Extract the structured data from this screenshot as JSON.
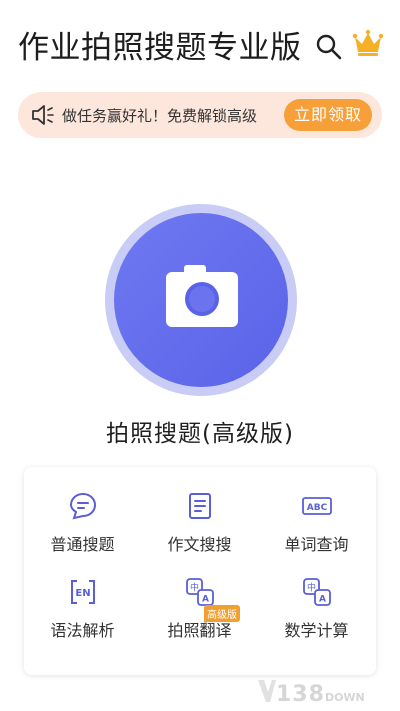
{
  "header": {
    "title": "作业拍照搜题专业版"
  },
  "banner": {
    "text": "做任务赢好礼！免费解锁高级",
    "button_label": "立即领取"
  },
  "main": {
    "label": "拍照搜题(高级版)"
  },
  "tools": [
    {
      "label": "普通搜题",
      "icon": "chat-bubble-icon"
    },
    {
      "label": "作文搜搜",
      "icon": "document-icon"
    },
    {
      "label": "单词查询",
      "icon": "abc-icon"
    },
    {
      "label": "语法解析",
      "icon": "en-icon"
    },
    {
      "label": "拍照翻译",
      "icon": "translate-icon",
      "badge": "高级版"
    },
    {
      "label": "数学计算",
      "icon": "translate-icon"
    }
  ],
  "watermark": {
    "number": "138",
    "suffix": "DOWN"
  },
  "colors": {
    "accent": "#5a63e8",
    "button": "#f7a03a",
    "banner_bg": "#fde7dc",
    "icon_stroke": "#5a5fd8"
  }
}
